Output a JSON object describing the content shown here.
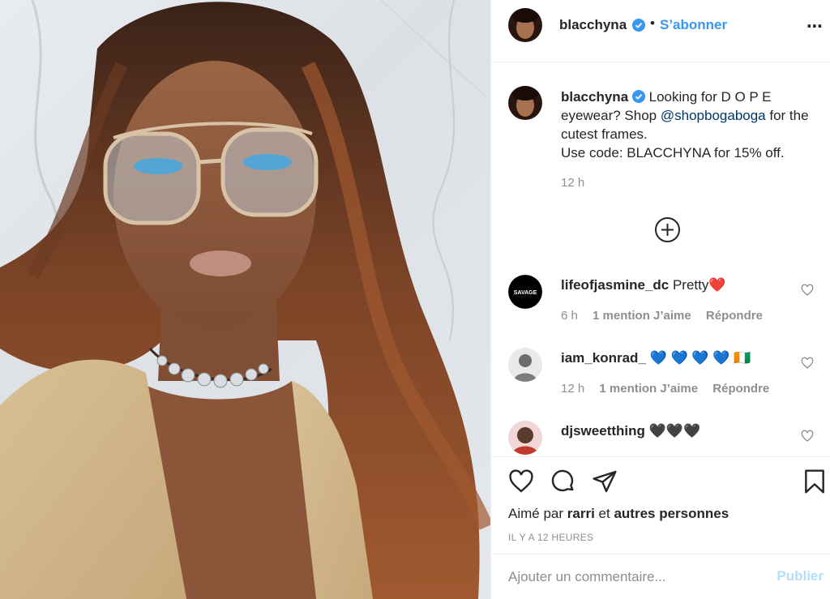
{
  "post": {
    "author": "blacchyna",
    "follow_label": "S’abonner",
    "separator": "•",
    "more_icon": "⋯",
    "photo_alt": "Selfie photo"
  },
  "caption": {
    "username": "blacchyna",
    "text_before": "Looking for D O P E eyewear? Shop ",
    "mention": "@shopbogaboga",
    "text_after": " for the cutest frames.",
    "line2": "Use code: BLACCHYNA for 15% off.",
    "time": "12 h"
  },
  "load_more": {
    "icon": "plus-circle-icon"
  },
  "comments": [
    {
      "username": "lifeofjasmine_dc",
      "text": "Pretty❤️",
      "time": "6 h",
      "likes": "1 mention J’aime",
      "reply": "Répondre",
      "avatar_text": "SAVAGE"
    },
    {
      "username": "iam_konrad_",
      "text": "💙 💙 💙 💙 🇨🇮",
      "time": "12 h",
      "likes": "1 mention J’aime",
      "reply": "Répondre"
    },
    {
      "username": "djsweetthing",
      "text": "🖤🖤🖤"
    }
  ],
  "actions": {
    "liked_by_prefix": "Aimé par",
    "liked_by_user": "rarri",
    "liked_by_connector": "et",
    "liked_by_suffix": "autres personnes",
    "timestamp": "IL Y A 12 HEURES"
  },
  "add_comment": {
    "placeholder": "Ajouter un commentaire...",
    "publish_label": "Publier"
  },
  "colors": {
    "link": "#3897f0",
    "mention": "#00376b",
    "muted": "#8e8e8e",
    "publish_disabled": "#b2dffc",
    "verified": "#3897f0"
  }
}
